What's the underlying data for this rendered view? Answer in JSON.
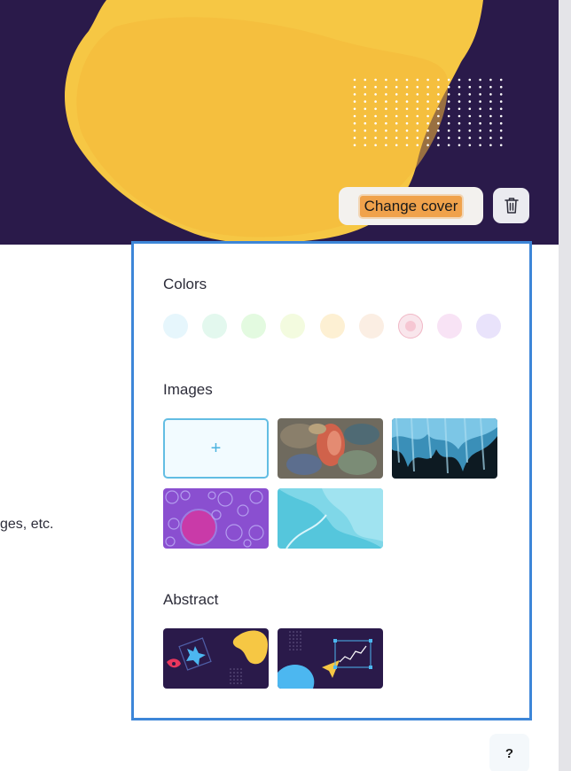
{
  "cover": {
    "change_cover_label": "Change cover",
    "delete_icon": "trash-icon",
    "colors": {
      "background": "#2a1a4a",
      "blob": "#f6c744"
    }
  },
  "body": {
    "fragment_text": "ges, etc."
  },
  "picker": {
    "colors_title": "Colors",
    "colors": [
      "#e6f6fc",
      "#e3f8ee",
      "#e3fae0",
      "#f3fbdf",
      "#fdf0d3",
      "#fbeee3",
      "#f9e6ec",
      "#f8e3f5",
      "#e9e3fb"
    ],
    "selected_color_index": 6,
    "images_title": "Images",
    "upload_label": "+",
    "images": [
      "oil-paint-texture",
      "blue-brush-strokes",
      "purple-bubbles",
      "light-blue-glass"
    ],
    "abstract_title": "Abstract",
    "abstracts": [
      "abstract-shapes-1",
      "abstract-shapes-2"
    ]
  },
  "help": {
    "label": "?"
  }
}
